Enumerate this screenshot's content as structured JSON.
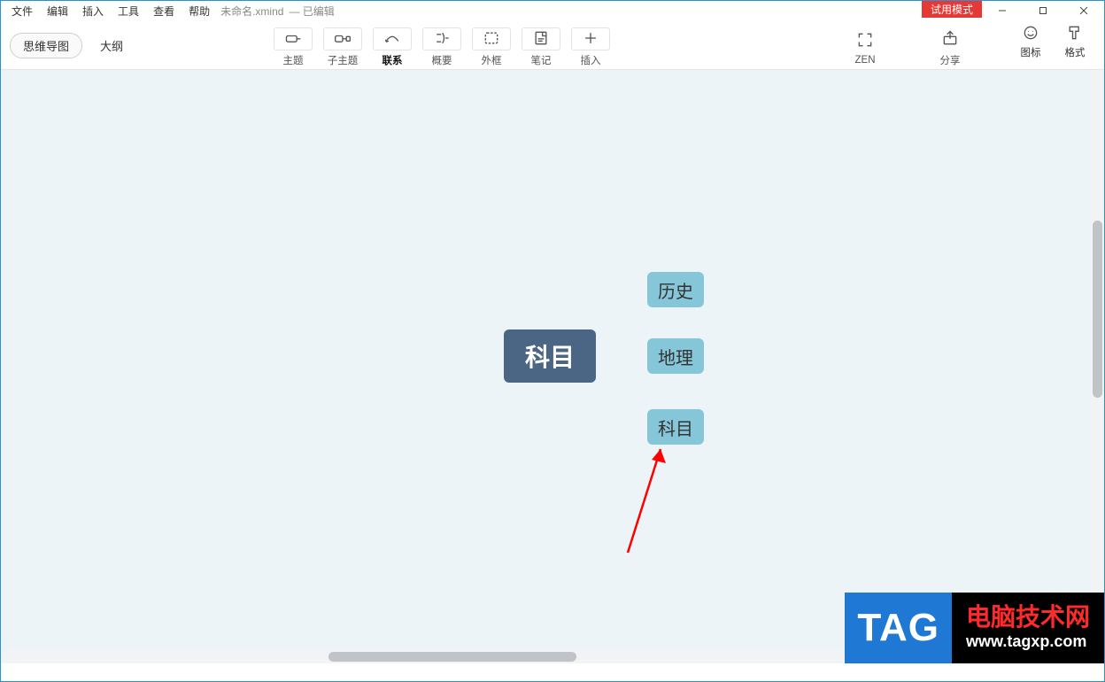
{
  "menubar": {
    "items": [
      "文件",
      "编辑",
      "插入",
      "工具",
      "查看",
      "帮助"
    ],
    "doc_name": "未命名.xmind",
    "doc_status": "— 已编辑"
  },
  "trial_badge": "试用模式",
  "view": {
    "mindmap": "思维导图",
    "outline": "大纲"
  },
  "toolbar": {
    "topic": "主题",
    "subtopic": "子主题",
    "relation": "联系",
    "summary": "概要",
    "boundary": "外框",
    "note": "笔记",
    "insert": "插入",
    "zen": "ZEN",
    "share": "分享",
    "icons": "图标",
    "format": "格式"
  },
  "mindmap": {
    "root": "科目",
    "children": [
      "历史",
      "地理",
      "科目"
    ]
  },
  "watermark": {
    "tag": "TAG",
    "line1": "电脑技术网",
    "line2": "www.tagxp.com"
  }
}
